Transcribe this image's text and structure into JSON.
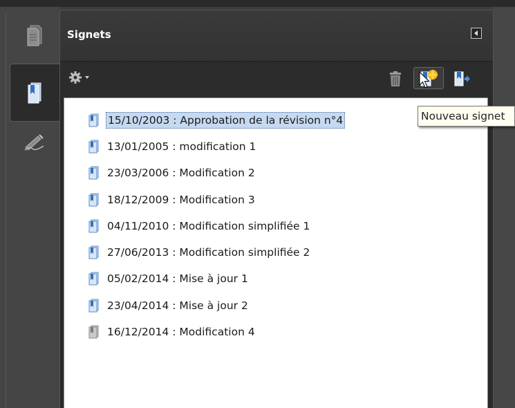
{
  "panel": {
    "title": "Signets"
  },
  "toolbar": {
    "options_icon": "gear-icon",
    "delete_icon": "trash-icon",
    "new_bookmark_icon": "new-bookmark-icon",
    "expand_icon": "expand-bookmark-icon"
  },
  "tooltip": {
    "text": "Nouveau signet"
  },
  "bookmarks": [
    {
      "label": "15/10/2003 : Approbation de la révision n°4",
      "selected": true,
      "style": "blue"
    },
    {
      "label": "13/01/2005 : modification 1",
      "selected": false,
      "style": "blue"
    },
    {
      "label": "23/03/2006 : Modification 2",
      "selected": false,
      "style": "blue"
    },
    {
      "label": "18/12/2009 : Modification 3",
      "selected": false,
      "style": "blue"
    },
    {
      "label": "04/11/2010 : Modification simplifiée 1",
      "selected": false,
      "style": "blue"
    },
    {
      "label": "27/06/2013 : Modification simplifiée 2",
      "selected": false,
      "style": "blue"
    },
    {
      "label": "05/02/2014 : Mise à jour 1",
      "selected": false,
      "style": "blue"
    },
    {
      "label": "23/04/2014 : Mise à jour 2",
      "selected": false,
      "style": "blue"
    },
    {
      "label": "16/12/2014 : Modification 4",
      "selected": false,
      "style": "gray"
    }
  ],
  "colors": {
    "selection": "#c5d9f0",
    "panel_bg": "#2a2a2a",
    "list_bg": "#ffffff"
  }
}
